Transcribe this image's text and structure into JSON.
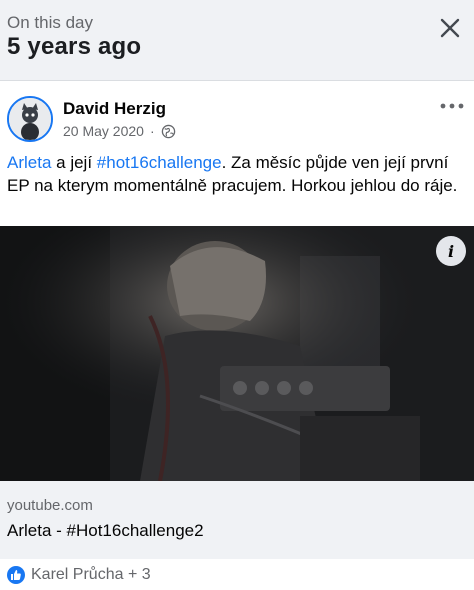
{
  "header": {
    "subtitle": "On this day",
    "title": "5 years ago",
    "close_icon": "close-icon"
  },
  "post": {
    "author": "David Herzig",
    "date": "20 May 2020",
    "date_separator": "·",
    "privacy_icon": "globe-icon",
    "more_icon": "more-horizontal-icon",
    "text": {
      "mention": "Arleta",
      "part1": " a její ",
      "hashtag": "#hot16challenge",
      "part2": ". Za měsíc půjde ven její první EP na kterym momentálně pracujem. Horkou jehlou do ráje."
    }
  },
  "media": {
    "info_icon": "info-icon",
    "info_label": "i"
  },
  "link_preview": {
    "domain": "youtube.com",
    "title": "Arleta - #Hot16challenge2"
  },
  "reactions": {
    "icon": "like-icon",
    "text": "Karel Průcha + 3"
  },
  "colors": {
    "accent": "#1877f2",
    "secondary_text": "#65676b",
    "background": "#f0f2f5"
  }
}
